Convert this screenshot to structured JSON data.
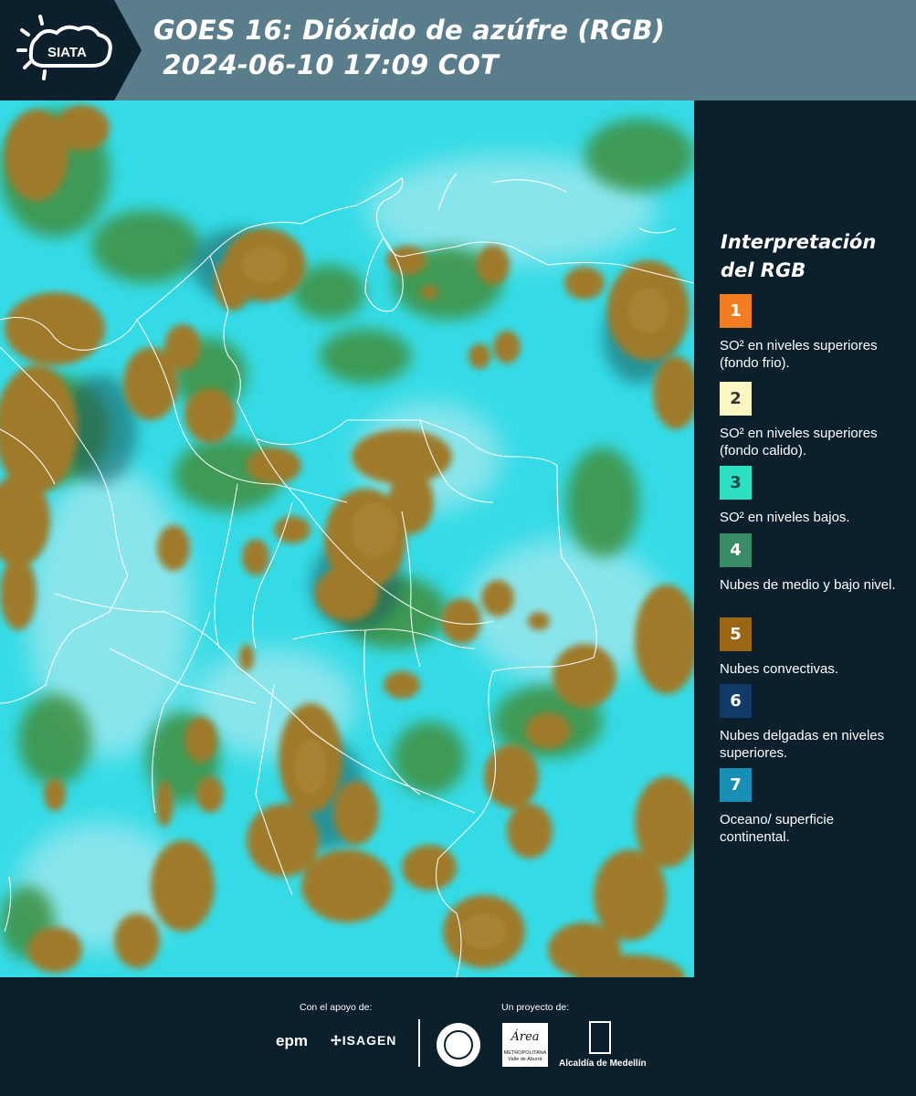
{
  "header": {
    "logo_text": "SIATA",
    "title": "GOES 16: Dióxido de azúfre (RGB)",
    "datetime": " 2024-06-10 17:09 COT"
  },
  "legend": {
    "title": "Interpretación del RGB",
    "items": [
      {
        "number": "1",
        "color": "#f47c20",
        "description": "SO² en niveles superiores (fondo frio)."
      },
      {
        "number": "2",
        "color": "#fdf7c3",
        "description": "SO² en niveles superiores (fondo calido)."
      },
      {
        "number": "3",
        "color": "#2de0c3",
        "description": "SO² en niveles bajos."
      },
      {
        "number": "4",
        "color": "#3a8c66",
        "description": "Nubes de medio y bajo nivel."
      },
      {
        "number": "5",
        "color": "#9a6614",
        "description": "Nubes convectivas."
      },
      {
        "number": "6",
        "color": "#123a66",
        "description": "Nubes delgadas en niveles superiores."
      },
      {
        "number": "7",
        "color": "#1a8fb5",
        "description": "Oceano/ superficie continental."
      }
    ]
  },
  "footer": {
    "support_label": "Con el apoyo de:",
    "project_label": "Un proyecto de:",
    "sponsor_1": "epm",
    "sponsor_2": "ISAGEN",
    "area_logo": "Área",
    "area_sub": "METROPOLITANA Valle de Aburrá",
    "alcaldia": "Alcaldía de Medellín"
  }
}
